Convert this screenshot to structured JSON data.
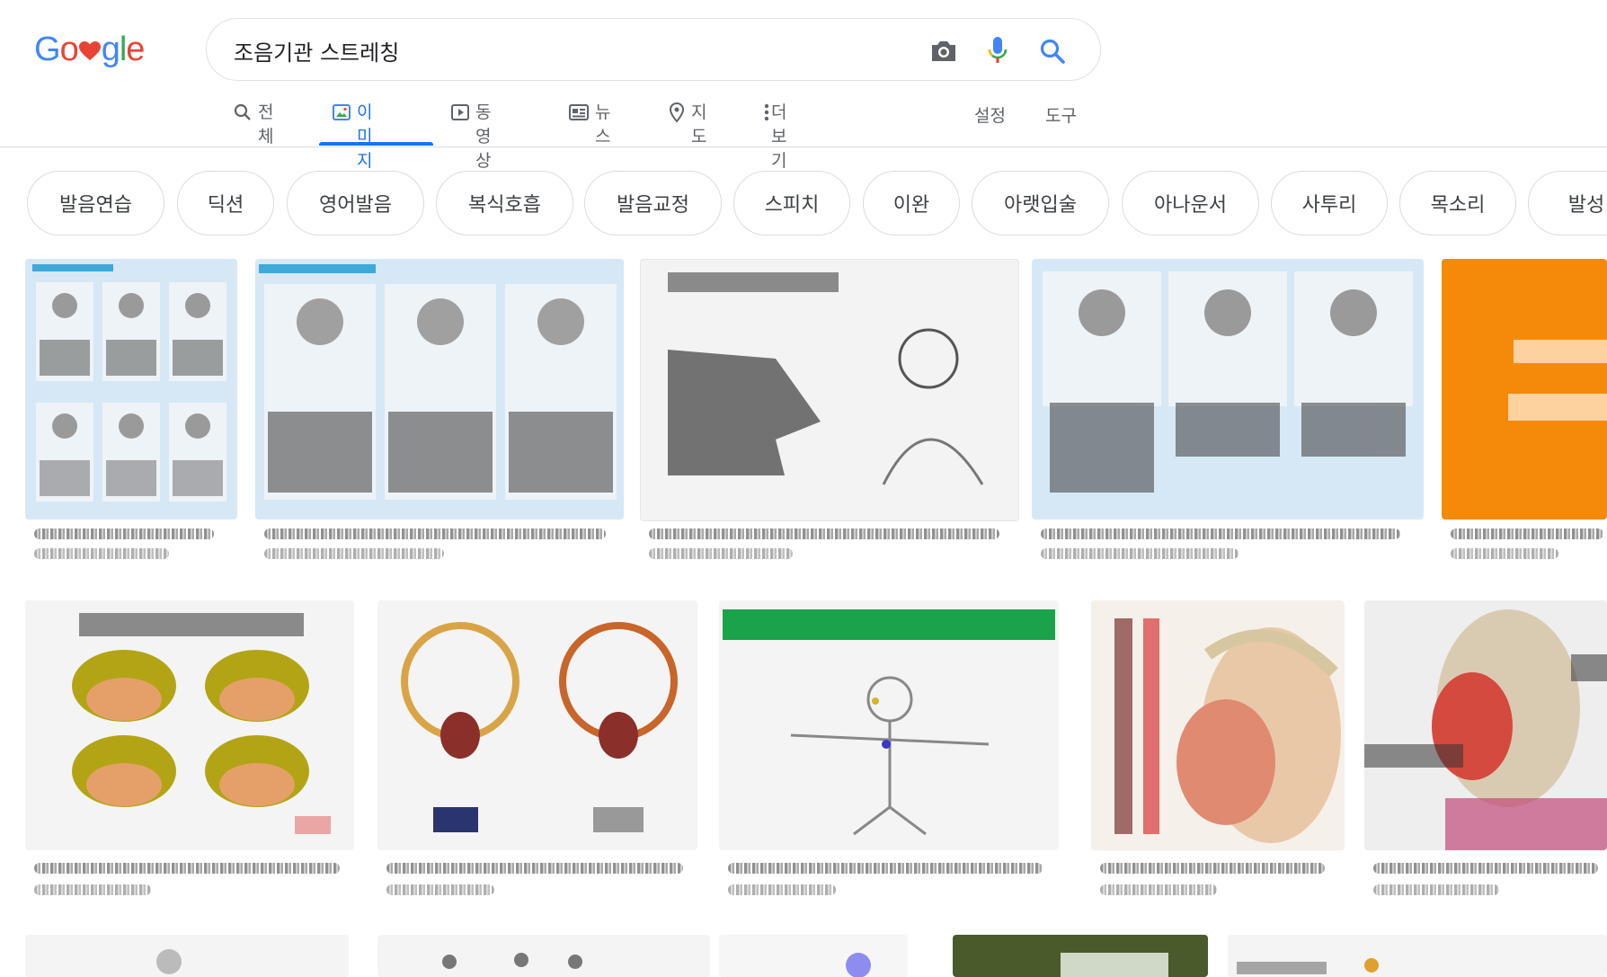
{
  "logo": {
    "letters": [
      "G",
      "o",
      "g",
      "l",
      "e"
    ]
  },
  "search": {
    "query": "조음기관 스트레칭"
  },
  "tabs": [
    {
      "label": "전체",
      "icon": "search-icon"
    },
    {
      "label": "이미지",
      "icon": "image-icon"
    },
    {
      "label": "동영상",
      "icon": "play-icon"
    },
    {
      "label": "뉴스",
      "icon": "news-icon"
    },
    {
      "label": "지도",
      "icon": "map-pin-icon"
    },
    {
      "label": "더보기",
      "icon": "more-vert-icon"
    }
  ],
  "tools": {
    "settings": "설정",
    "tools": "도구"
  },
  "chips": [
    "발음연습",
    "딕션",
    "영어발음",
    "복식호흡",
    "발음교정",
    "스피치",
    "이완",
    "아랫입술",
    "아나운서",
    "사투리",
    "목소리",
    "발성"
  ],
  "colors": {
    "accent": "#1a73e8",
    "chip_border": "#dadce0"
  }
}
